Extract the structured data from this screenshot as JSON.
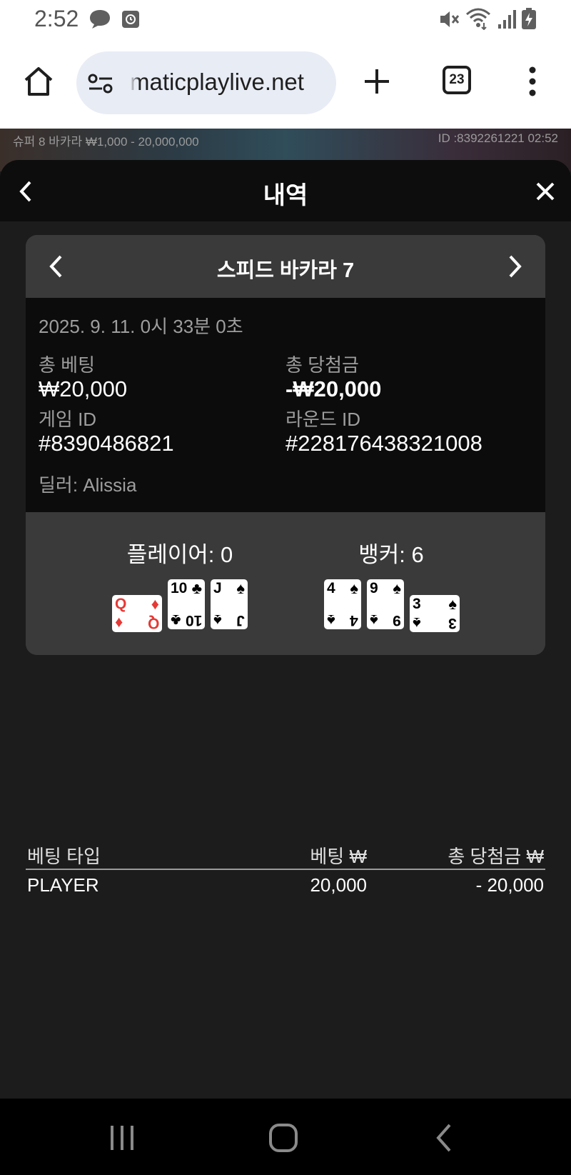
{
  "status_bar": {
    "time": "2:52",
    "icons": [
      "chat-bubble-icon",
      "alarm-app-icon",
      "mute-icon",
      "wifi-icon",
      "signal-icon",
      "battery-charging-icon"
    ]
  },
  "browser": {
    "url": "maticplaylive.net",
    "tab_count": "23"
  },
  "game_strip": {
    "table_info": "슈퍼 8 바카라 ₩1,000 - 20,000,000",
    "id_info": "ID :8392261221 02:52"
  },
  "sheet": {
    "title": "내역",
    "game": {
      "name": "스피드 바카라 7",
      "datetime": "2025. 9. 11. 0시 33분 0초",
      "total_bet_label": "총 베팅",
      "total_bet_value": "₩20,000",
      "total_win_label": "총 당첨금",
      "total_win_value": "-₩20,000",
      "game_id_label": "게임 ID",
      "game_id_value": "#8390486821",
      "round_id_label": "라운드 ID",
      "round_id_value": "#228176438321008",
      "dealer": "딜러: Alissia",
      "player_score": "플레이어: 0",
      "banker_score": "뱅커: 6",
      "player_cards": [
        {
          "rank": "Q",
          "suit": "♦",
          "color": "#e53935",
          "sideways": true
        },
        {
          "rank": "10",
          "suit": "♣",
          "color": "#000000",
          "sideways": false
        },
        {
          "rank": "J",
          "suit": "♠",
          "color": "#000000",
          "sideways": false
        }
      ],
      "banker_cards": [
        {
          "rank": "4",
          "suit": "♠",
          "color": "#000000",
          "sideways": false
        },
        {
          "rank": "9",
          "suit": "♠",
          "color": "#000000",
          "sideways": false
        },
        {
          "rank": "3",
          "suit": "♠",
          "color": "#000000",
          "sideways": true
        }
      ]
    },
    "bets_table": {
      "headers": [
        "베팅 타입",
        "베팅 ₩",
        "총 당첨금 ₩"
      ],
      "rows": [
        {
          "type": "PLAYER",
          "bet": "20,000",
          "win": "- 20,000"
        }
      ]
    }
  }
}
